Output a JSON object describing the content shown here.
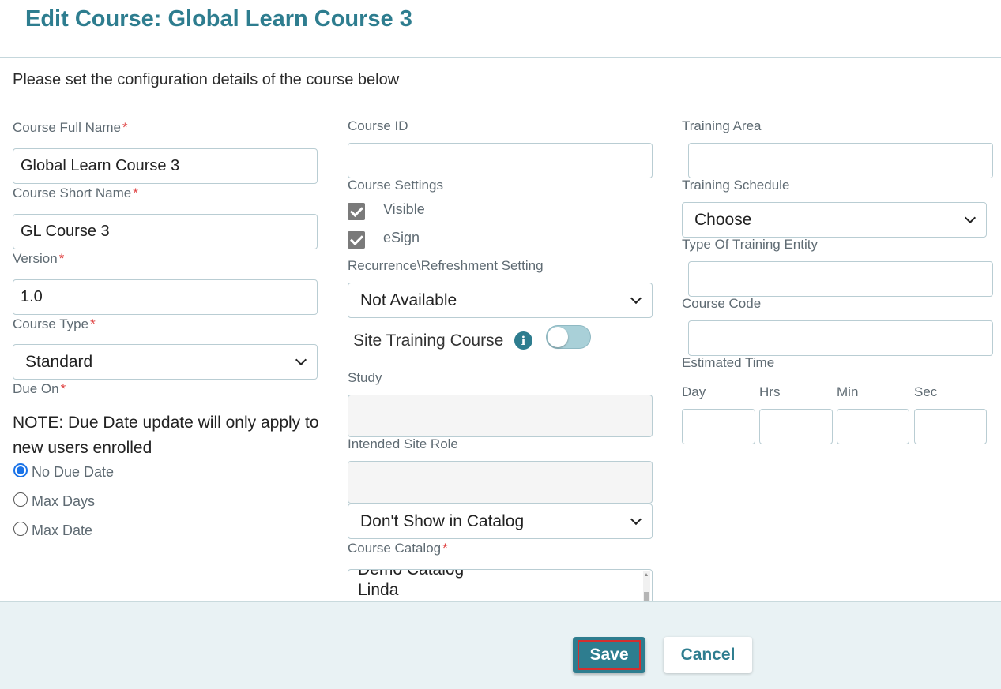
{
  "header": {
    "title": "Edit Course: Global Learn Course 3"
  },
  "intro": "Please set the configuration details of the course below",
  "required_marker": "*",
  "col1": {
    "full_name_label": "Course Full Name",
    "full_name_value": "Global Learn Course 3",
    "short_name_label": "Course Short Name",
    "short_name_value": "GL Course 3",
    "version_label": "Version",
    "version_value": "1.0",
    "course_type_label": "Course Type",
    "course_type_value": "Standard",
    "due_on_label": "Due On",
    "due_note": "NOTE: Due Date update will only apply to new users enrolled",
    "due_options": [
      {
        "label": "No Due Date",
        "selected": true
      },
      {
        "label": "Max Days",
        "selected": false
      },
      {
        "label": "Max Date",
        "selected": false
      }
    ]
  },
  "col2": {
    "course_id_label": "Course ID",
    "course_id_value": "",
    "settings_label": "Course Settings",
    "visible_label": "Visible",
    "visible_checked": true,
    "esign_label": "eSign",
    "esign_checked": true,
    "recurrence_label": "Recurrence\\Refreshment Setting",
    "recurrence_value": "Not Available",
    "site_training_label": "Site Training Course",
    "site_training_on": false,
    "info_glyph": "i",
    "study_label": "Study",
    "intended_role_label": "Intended Site Role",
    "catalog_visibility_value": "Don't Show in Catalog",
    "catalog_label": "Course Catalog",
    "catalog_items": [
      "Demo Catalog",
      "Linda"
    ]
  },
  "col3": {
    "training_area_label": "Training Area",
    "training_schedule_label": "Training Schedule",
    "training_schedule_value": "Choose",
    "entity_type_label": "Type Of Training Entity",
    "course_code_label": "Course Code",
    "estimated_time_label": "Estimated Time",
    "time_units": {
      "day": "Day",
      "hrs": "Hrs",
      "min": "Min",
      "sec": "Sec"
    }
  },
  "footer": {
    "save_label": "Save",
    "cancel_label": "Cancel"
  },
  "colors": {
    "accent": "#2e7d8f",
    "required": "#e04646",
    "focus_outline": "#d32f2f",
    "radio_selected": "#1a73e8"
  },
  "icons": {
    "info": "info-icon",
    "dropdown": "chevron-down-icon",
    "check": "checkmark-icon"
  }
}
